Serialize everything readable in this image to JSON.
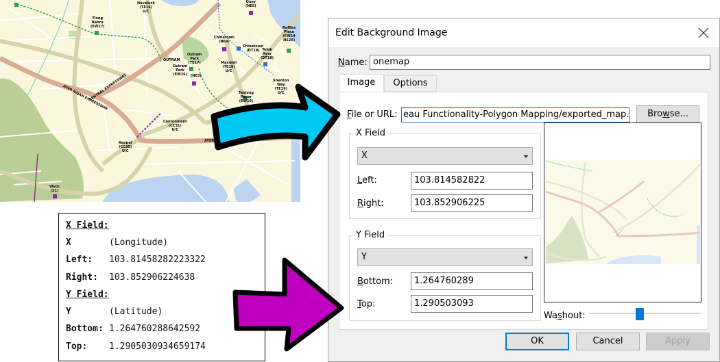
{
  "map": {
    "labels": [
      {
        "text": "Havelock\n(TE16)\nU/C",
        "color": "#8a4a8a"
      },
      {
        "text": "Tiong\nBahru\n(EW17)",
        "color": "#2e7d32"
      },
      {
        "text": "Chinatown\n(NE4)",
        "color": "#8e24aa"
      },
      {
        "text": "Chinatown\n(DT19)",
        "color": "#1e5fb0"
      },
      {
        "text": "Telok\nAyer\n(DT18)",
        "color": "#1e5fb0"
      },
      {
        "text": "Outram\nPark\n(TE17)",
        "color": "#b5651d"
      },
      {
        "text": "Outram\nPark\n(EW16)",
        "color": "#2e7d32"
      },
      {
        "text": "(NE3)",
        "color": "#8e24aa"
      },
      {
        "text": "Maxwell\n(TE18)\nU/C",
        "color": "#8a4a3a"
      },
      {
        "text": "Shenton\nWay\n(TE19)\nU/C",
        "color": "#8a4a3a"
      },
      {
        "text": "Tanjong\nPagar\n(EW15)",
        "color": "#2e7d32"
      },
      {
        "text": "Raffles\nPlace\n(EW14\nNS26)",
        "color": "#2e7d32"
      },
      {
        "text": "Quay\n(NE5)",
        "color": "#8e24aa"
      },
      {
        "text": "OUTRAM",
        "color": "#1b5e20"
      },
      {
        "text": "Cantonment\n(CC31)\nU/C",
        "color": "#333333"
      },
      {
        "text": "Keppel\n(CC30)\nU/C",
        "color": "#333333"
      },
      {
        "text": "Vivoc\n(S1)",
        "color": "#333333"
      },
      {
        "text": "CENTRAL EXPRESSWAY",
        "color": "#6d4c41"
      },
      {
        "text": "AYER RAJAH EXPRESSWAY",
        "color": "#6d4c41"
      },
      {
        "text": "AYER",
        "color": "#6d4c41"
      }
    ]
  },
  "notes": {
    "x_header": "X Field:",
    "x_var": "X",
    "x_desc": "(Longitude)",
    "left_label": "Left:",
    "left_value": "103.81458282223322",
    "right_label": "Right:",
    "right_value": "103.852906224638",
    "y_header": "Y Field:",
    "y_var": "Y",
    "y_desc": "(Latitude)",
    "bottom_label": "Bottom:",
    "bottom_value": "1.264760288642592",
    "top_label": "Top:",
    "top_value": "1.2905030934659174"
  },
  "arrows": {
    "top_color": "#00c8f5",
    "bottom_color": "#c000c0"
  },
  "dialog": {
    "title": "Edit Background Image",
    "name_label_first": "N",
    "name_label_rest": "ame:",
    "name_value": "onemap",
    "tabs": [
      {
        "label": "Image",
        "active": true
      },
      {
        "label": "Options",
        "active": false
      }
    ],
    "file_label_first": "F",
    "file_label_rest": "ile or URL:",
    "file_value": "eau Functionality-Polygon Mapping/exported_map.png",
    "browse_pre": "Bro",
    "browse_u": "w",
    "browse_post": "se...",
    "x_field": {
      "legend": "X Field",
      "selected": "X",
      "left_first": "L",
      "left_rest": "eft:",
      "left_value": "103.814582822",
      "right_first": "R",
      "right_rest": "ight:",
      "right_value": "103.852906225"
    },
    "y_field": {
      "legend": "Y Field",
      "selected": "Y",
      "bottom_first": "B",
      "bottom_rest": "ottom:",
      "bottom_value": "1.264760289",
      "top_first": "T",
      "top_rest": "op:",
      "top_value": "1.290503093"
    },
    "washout_pre": "Wa",
    "washout_u": "s",
    "washout_post": "hout:",
    "washout_level": 0.45,
    "ok_label": "OK",
    "cancel_label": "Cancel",
    "apply_label": "Apply",
    "accent": "#0078d7"
  }
}
